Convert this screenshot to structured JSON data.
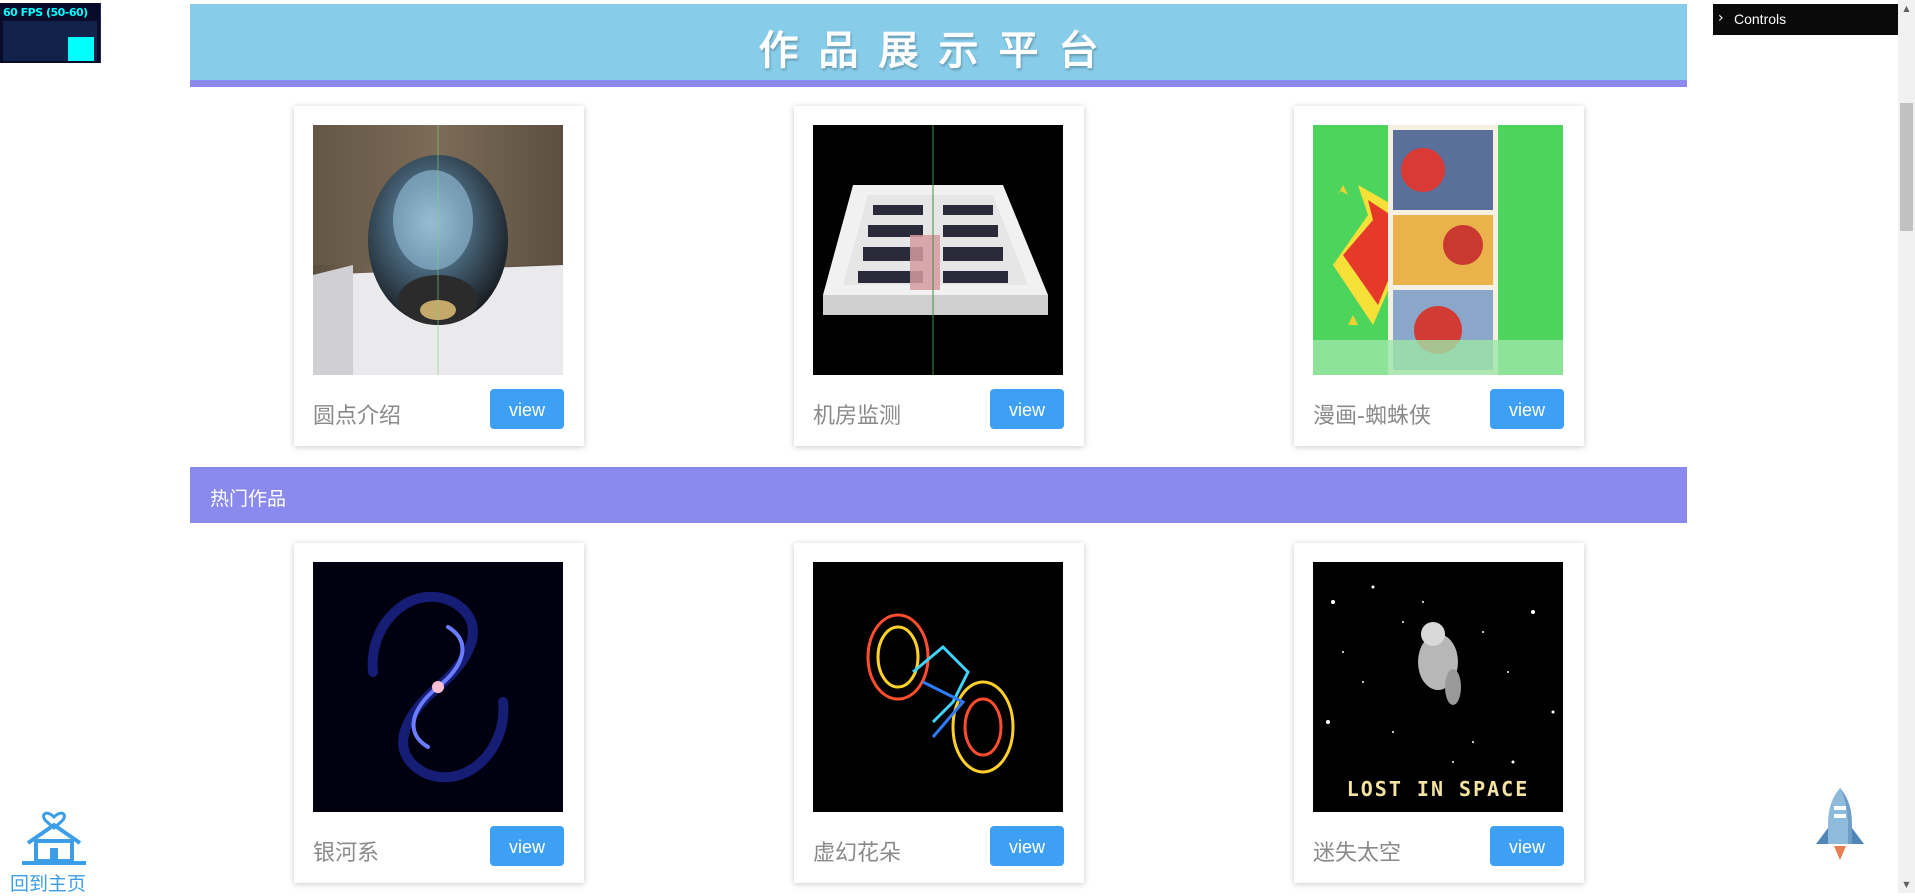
{
  "fps": {
    "text": "60 FPS (50-60)"
  },
  "controls": {
    "label": "Controls",
    "icon": "chevron-right-icon"
  },
  "banner": {
    "title": "作品展示平台"
  },
  "section": {
    "title": "热门作品"
  },
  "cards_top": [
    {
      "name": "圆点介绍",
      "button": "view",
      "thumb": "helmet-model"
    },
    {
      "name": "机房监测",
      "button": "view",
      "thumb": "server-room-model"
    },
    {
      "name": "漫画-蜘蛛侠",
      "button": "view",
      "thumb": "spiderman-comic"
    }
  ],
  "cards_hot": [
    {
      "name": "银河系",
      "button": "view",
      "thumb": "galaxy"
    },
    {
      "name": "虚幻花朵",
      "button": "view",
      "thumb": "neon-flower"
    },
    {
      "name": "迷失太空",
      "button": "view",
      "thumb": "lost-in-space",
      "caption": "LOST IN SPACE"
    }
  ],
  "home": {
    "label": "回到主页",
    "icon": "home-heart-icon"
  },
  "rocket": {
    "icon": "rocket-icon"
  },
  "colors": {
    "banner": "#87cdea",
    "accent": "#8a89ee",
    "button": "#3ea0f5",
    "link": "#3c9ee6"
  }
}
